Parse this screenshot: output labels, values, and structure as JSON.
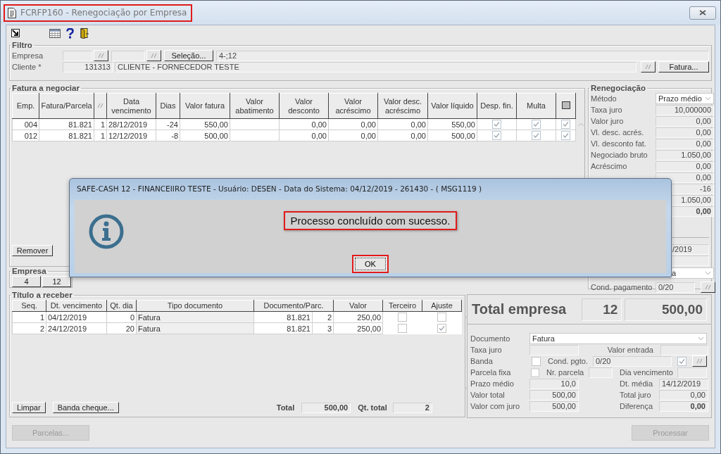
{
  "window": {
    "title": "FCRFP160 - Renegociação por Empresa",
    "highlighted": true
  },
  "filtro": {
    "title": "Filtro",
    "empresa_label": "Empresa",
    "selecao_button": "Seleção...",
    "empresa_value": "4-;12",
    "cliente_label": "Cliente *",
    "cliente_code": "131313",
    "cliente_name": "CLIENTE - FORNECEDOR TESTE",
    "fatura_button": "Fatura..."
  },
  "fatura": {
    "title": "Fatura a negociar",
    "columns": [
      {
        "kind": "text",
        "label": "Emp."
      },
      {
        "kind": "text",
        "label": "Fatura/Parcela"
      },
      {
        "kind": "icon"
      },
      {
        "kind": "text",
        "label": "Data vencimento"
      },
      {
        "kind": "text",
        "label": "Dias"
      },
      {
        "kind": "text",
        "label": "Valor fatura"
      },
      {
        "kind": "text",
        "label": "Valor abatimento"
      },
      {
        "kind": "text",
        "label": "Valor desconto"
      },
      {
        "kind": "text",
        "label": "Valor acréscimo"
      },
      {
        "kind": "text",
        "label": "Valor desc. acréscimo"
      },
      {
        "kind": "text",
        "label": "Valor líquido"
      },
      {
        "kind": "text",
        "label": "Desp. fin."
      },
      {
        "kind": "text",
        "label": "Multa"
      },
      {
        "kind": "icon"
      }
    ],
    "rows": [
      {
        "emp": "004",
        "fatura": "81.821",
        "parcela": "1",
        "vencimento": "28/12/2019",
        "dias": "-24",
        "valor_fatura": "550,00",
        "valor_desconto": "0,00",
        "valor_acrescimo": "0,00",
        "valor_desc_acrescimo": "0,00",
        "valor_liquido": "550,00",
        "desp_fin": true,
        "multa": true,
        "selected": true
      },
      {
        "emp": "012",
        "fatura": "81.821",
        "parcela": "1",
        "vencimento": "12/12/2019",
        "dias": "-8",
        "valor_fatura": "500,00",
        "valor_desconto": "0,00",
        "valor_acrescimo": "0,00",
        "valor_desc_acrescimo": "0,00",
        "valor_liquido": "500,00",
        "desp_fin": true,
        "multa": true,
        "selected": true
      }
    ],
    "remove_button": "Remover"
  },
  "empresa": {
    "title": "Empresa",
    "buttons": [
      "4",
      "12"
    ]
  },
  "renegociacao": {
    "title": "Renegociação",
    "rows": [
      {
        "kind": "select",
        "label": "Método",
        "value": "Prazo médio"
      },
      {
        "kind": "field",
        "label": "Taxa juro",
        "value": "10,000000"
      },
      {
        "kind": "field",
        "label": "Valor juro",
        "value": "0,00"
      },
      {
        "kind": "field",
        "label": "Vl. desc. acrés.",
        "value": "0,00"
      },
      {
        "kind": "field",
        "label": "Vl. desconto fat.",
        "value": "0,00"
      },
      {
        "kind": "field",
        "label": "Negociado bruto",
        "value": "1.050,00"
      },
      {
        "kind": "field",
        "label": "Acréscimo",
        "value": "0,00"
      },
      {
        "kind": "field",
        "value": "0,00"
      },
      {
        "kind": "field",
        "value": "-16"
      },
      {
        "kind": "field",
        "value": "1.050,00"
      },
      {
        "kind": "field",
        "value": "0,00",
        "bold": true
      }
    ],
    "lower": [
      {
        "kind": "field",
        "value": "/2019"
      },
      {
        "kind": "field"
      },
      {
        "kind": "select",
        "value": "a"
      },
      {
        "kind": "lookup",
        "label": "Cond. pagamento",
        "value": "0/20"
      }
    ]
  },
  "titulo": {
    "title": "Título a receber",
    "columns": [
      "Seq.",
      "Dt. vencimento",
      "Qt. dia",
      "Tipo documento",
      "Documento/Parc.",
      "Valor",
      "Terceiro",
      "Ajuste"
    ],
    "rows": [
      {
        "seq": "1",
        "vencimento": "04/12/2019",
        "qt_dia": "0",
        "tipo": "Fatura",
        "documento": "81.821",
        "parcela": "2",
        "valor": "250,00",
        "terceiro": false,
        "ajuste": false
      },
      {
        "seq": "2",
        "vencimento": "24/12/2019",
        "qt_dia": "20",
        "tipo": "Fatura",
        "documento": "81.821",
        "parcela": "3",
        "valor": "250,00",
        "terceiro": false,
        "ajuste": true
      }
    ],
    "buttons": [
      "Limpar",
      "Banda cheque..."
    ],
    "total_label": "Total",
    "total": "500,00",
    "qt_total_label": "Qt. total",
    "qt_total": "2"
  },
  "resumo": {
    "title": "Total empresa",
    "count": "12",
    "total": "500,00",
    "documento_label": "Documento",
    "documento": "Fatura",
    "taxa_juro_label": "Taxa juro",
    "valor_entrada_label": "Valor entrada",
    "banda_label": "Banda",
    "banda": false,
    "cond_pgto_label": "Cond. pgto.",
    "cond_pgto": "0/20",
    "cond_pgto_checked": true,
    "parcela_fixa_label": "Parcela fixa",
    "parcela_fixa": false,
    "nr_parcela_label": "Nr. parcela",
    "dia_vencimento_label": "Dia vencimento",
    "prazo_medio_label": "Prazo médio",
    "prazo_medio": "10,0",
    "dt_media_label": "Dt. média",
    "dt_media": "14/12/2019",
    "valor_total_label": "Valor total",
    "valor_total": "500,00",
    "total_juro_label": "Total juro",
    "total_juro": "0,00",
    "valor_com_juro_label": "Valor com juro",
    "valor_com_juro": "500,00",
    "diferenca_label": "Diferença",
    "diferenca": "0,00"
  },
  "footer": {
    "buttons": [
      {
        "label": "Parcelas...",
        "disabled": true
      },
      {
        "label": "Processar",
        "disabled": true
      }
    ]
  },
  "dialog": {
    "title": "SAFE-CASH 12 - FINANCEIIRO TESTE - Usuário: DESEN - Data do Sistema: 04/12/2019 - 261430 - ( MSG1119 )",
    "message": "Processo concluído com sucesso.",
    "message_highlighted": true,
    "ok_button": "OK",
    "ok_highlighted": true
  }
}
